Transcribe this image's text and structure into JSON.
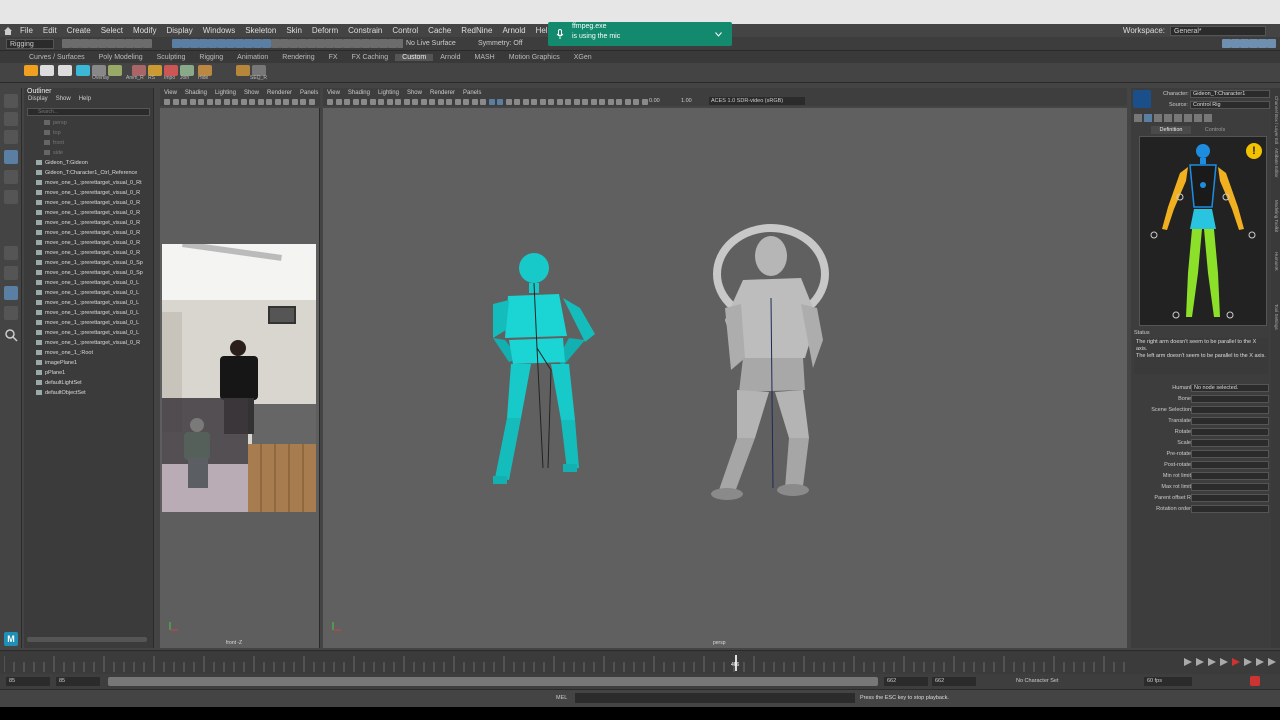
{
  "menubar": [
    "File",
    "Edit",
    "Create",
    "Select",
    "Modify",
    "Display",
    "Windows",
    "Skeleton",
    "Skin",
    "Deform",
    "Constrain",
    "Control",
    "Cache",
    "RedNine",
    "Arnold",
    "Help"
  ],
  "workspace": {
    "label": "Workspace:",
    "value": "General*"
  },
  "statusline": {
    "menuset": "Rigging",
    "live_surface": "No Live Surface",
    "symmetry": "Symmetry: Off"
  },
  "shelf_tabs": [
    "Curves / Surfaces",
    "Poly Modeling",
    "Sculpting",
    "Rigging",
    "Animation",
    "Rendering",
    "FX",
    "FX Caching",
    "Custom",
    "Arnold",
    "MASH",
    "Motion Graphics",
    "XGen"
  ],
  "shelf_active": "Custom",
  "shelf_icon_labels": [
    "Overlay",
    "Anim_R",
    "RS",
    "Impo",
    "Join",
    "Hide",
    "SEQ_R"
  ],
  "toast": {
    "title": "ffmpeg.exe",
    "subtitle": "is using the mic"
  },
  "outliner": {
    "title": "Outliner",
    "menus": [
      "Display",
      "Show",
      "Help"
    ],
    "search_placeholder": "Search...",
    "items": [
      {
        "label": "persp",
        "dim": true,
        "indent": 2
      },
      {
        "label": "top",
        "dim": true,
        "indent": 2
      },
      {
        "label": "front",
        "dim": true,
        "indent": 2
      },
      {
        "label": "side",
        "dim": true,
        "indent": 2
      },
      {
        "label": "Gideon_T:Gideon",
        "dim": false,
        "indent": 1
      },
      {
        "label": "Gideon_T:Character1_Ctrl_Reference",
        "dim": false,
        "indent": 1
      },
      {
        "label": "move_one_1_:prerettarget_visual_0_Rt",
        "dim": false,
        "indent": 1
      },
      {
        "label": "move_one_1_:prerettarget_visual_0_R",
        "dim": false,
        "indent": 1
      },
      {
        "label": "move_one_1_:prerettarget_visual_0_R",
        "dim": false,
        "indent": 1
      },
      {
        "label": "move_one_1_:prerettarget_visual_0_R",
        "dim": false,
        "indent": 1
      },
      {
        "label": "move_one_1_:prerettarget_visual_0_R",
        "dim": false,
        "indent": 1
      },
      {
        "label": "move_one_1_:prerettarget_visual_0_R",
        "dim": false,
        "indent": 1
      },
      {
        "label": "move_one_1_:prerettarget_visual_0_R",
        "dim": false,
        "indent": 1
      },
      {
        "label": "move_one_1_:prerettarget_visual_0_R",
        "dim": false,
        "indent": 1
      },
      {
        "label": "move_one_1_:prerettarget_visual_0_Sp",
        "dim": false,
        "indent": 1
      },
      {
        "label": "move_one_1_:prerettarget_visual_0_Sp",
        "dim": false,
        "indent": 1
      },
      {
        "label": "move_one_1_:prerettarget_visual_0_L",
        "dim": false,
        "indent": 1
      },
      {
        "label": "move_one_1_:prerettarget_visual_0_L",
        "dim": false,
        "indent": 1
      },
      {
        "label": "move_one_1_:prerettarget_visual_0_L",
        "dim": false,
        "indent": 1
      },
      {
        "label": "move_one_1_:prerettarget_visual_0_L",
        "dim": false,
        "indent": 1
      },
      {
        "label": "move_one_1_:prerettarget_visual_0_L",
        "dim": false,
        "indent": 1
      },
      {
        "label": "move_one_1_:prerettarget_visual_0_L",
        "dim": false,
        "indent": 1
      },
      {
        "label": "move_one_1_:prerettarget_visual_0_R",
        "dim": false,
        "indent": 1
      },
      {
        "label": "move_one_1_:Root",
        "dim": false,
        "indent": 1
      },
      {
        "label": "imagePlane1",
        "dim": false,
        "indent": 1
      },
      {
        "label": "pPlane1",
        "dim": false,
        "indent": 1
      },
      {
        "label": "defaultLightSet",
        "dim": false,
        "indent": 1
      },
      {
        "label": "defaultObjectSet",
        "dim": false,
        "indent": 1
      }
    ]
  },
  "panel_menus": [
    "View",
    "Shading",
    "Lighting",
    "Show",
    "Renderer",
    "Panels"
  ],
  "front_view_label": "front -Z",
  "persp_view_label": "persp",
  "persp_toolbar": {
    "value1": "0.00",
    "value2": "1.00",
    "colorspace": "ACES 1.0 SDR-video (sRGB)"
  },
  "humanik": {
    "character_label": "Character:",
    "character_value": "Gideon_T:Character1",
    "source_label": "Source:",
    "source_value": "Control Rig",
    "tabs": [
      "Definition",
      "Controls"
    ],
    "status_label": "Status",
    "status_text_1": "The right arm doesn't seem to be parallel to the X axis.",
    "status_text_2": "The left arm doesn't seem to be parallel to the X axis.",
    "props": [
      {
        "label": "HumanIK node",
        "value": "No node selected."
      },
      {
        "label": "Bone",
        "value": ""
      },
      {
        "label": "Scene Selection",
        "value": ""
      },
      {
        "label": "Translate",
        "value": ""
      },
      {
        "label": "Rotate",
        "value": ""
      },
      {
        "label": "Scale",
        "value": ""
      },
      {
        "label": "Pre-rotate",
        "value": ""
      },
      {
        "label": "Post-rotate",
        "value": ""
      },
      {
        "label": "Min rot limit",
        "value": ""
      },
      {
        "label": "Max rot limit",
        "value": ""
      },
      {
        "label": "Parent offset R",
        "value": ""
      },
      {
        "label": "Rotation order",
        "value": ""
      }
    ]
  },
  "side_tabs": [
    "Channel Box / Layer Editor",
    "Attribute Editor",
    "Modeling Toolkit",
    "HumanIK",
    "Tool Settings"
  ],
  "timeline": {
    "current_frame": "466",
    "start": "85",
    "range_start": "85",
    "range_end": "662",
    "end1": "662",
    "end2": "662",
    "char_set": "No Character Set",
    "fps": "60 fps"
  },
  "command": {
    "lang": "MEL",
    "help_text": "Press the ESC key to stop playback."
  }
}
